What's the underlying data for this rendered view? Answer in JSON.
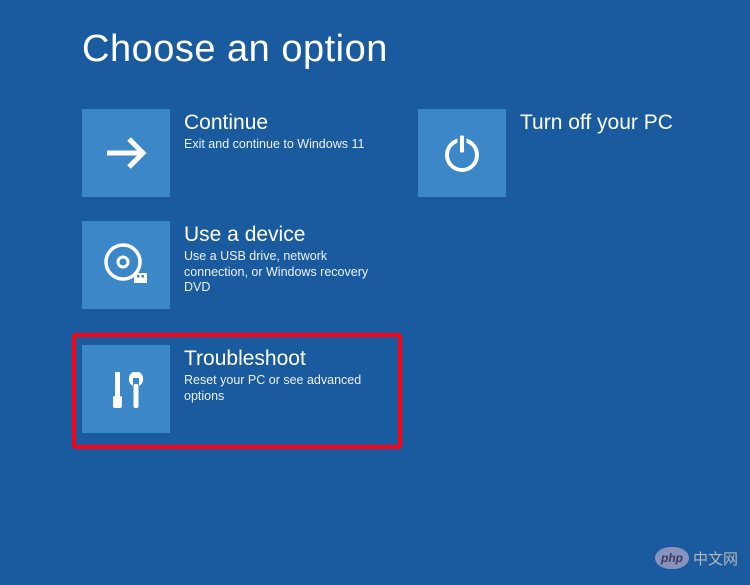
{
  "page": {
    "title": "Choose an option"
  },
  "options": {
    "continue": {
      "title": "Continue",
      "desc": "Exit and continue to Windows 11"
    },
    "turnoff": {
      "title": "Turn off your PC",
      "desc": ""
    },
    "device": {
      "title": "Use a device",
      "desc": "Use a USB drive, network connection, or Windows recovery DVD"
    },
    "troubleshoot": {
      "title": "Troubleshoot",
      "desc": "Reset your PC or see advanced options"
    }
  },
  "watermark": {
    "logo": "php",
    "text": "中文网"
  }
}
